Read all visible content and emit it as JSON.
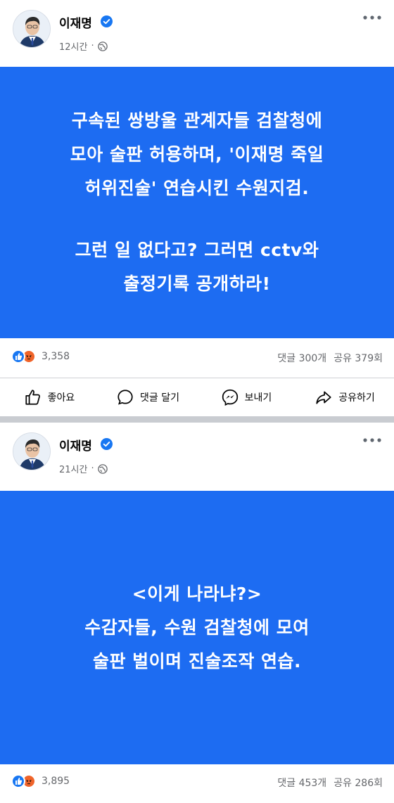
{
  "posts": [
    {
      "author": "이재명",
      "time": "12시간",
      "separator": "·",
      "card_lines": [
        "구속된 쌍방울 관계자들 검찰청에",
        "모아 술판 허용하며, '이재명 죽일",
        "허위진술' 연습시킨 수원지검."
      ],
      "card_lines_2": [
        "그런 일 없다고? 그러면 cctv와",
        "출정기록 공개하라!"
      ],
      "reaction_count": "3,358",
      "comments": "댓글 300개",
      "shares": "공유 379회",
      "actions": {
        "like": "좋아요",
        "comment": "댓글 달기",
        "send": "보내기",
        "share": "공유하기"
      }
    },
    {
      "author": "이재명",
      "time": "21시간",
      "separator": "·",
      "card_lines": [
        "<이게 나라냐?>",
        "수감자들, 수원 검찰청에 모여",
        "술판 벌이며 진술조작 연습."
      ],
      "reaction_count": "3,895",
      "comments": "댓글 453개",
      "shares": "공유 286회"
    }
  ],
  "colors": {
    "card_bg": "#1d6cf2",
    "like_blue": "#1877f2",
    "angry_orange": "#f0642a",
    "meta_gray": "#65676b"
  },
  "icons": [
    "verified-badge-icon",
    "globe-icon",
    "more-options-icon",
    "like-reaction-icon",
    "angry-reaction-icon",
    "thumbs-up-icon",
    "comment-icon",
    "messenger-icon",
    "share-arrow-icon"
  ]
}
